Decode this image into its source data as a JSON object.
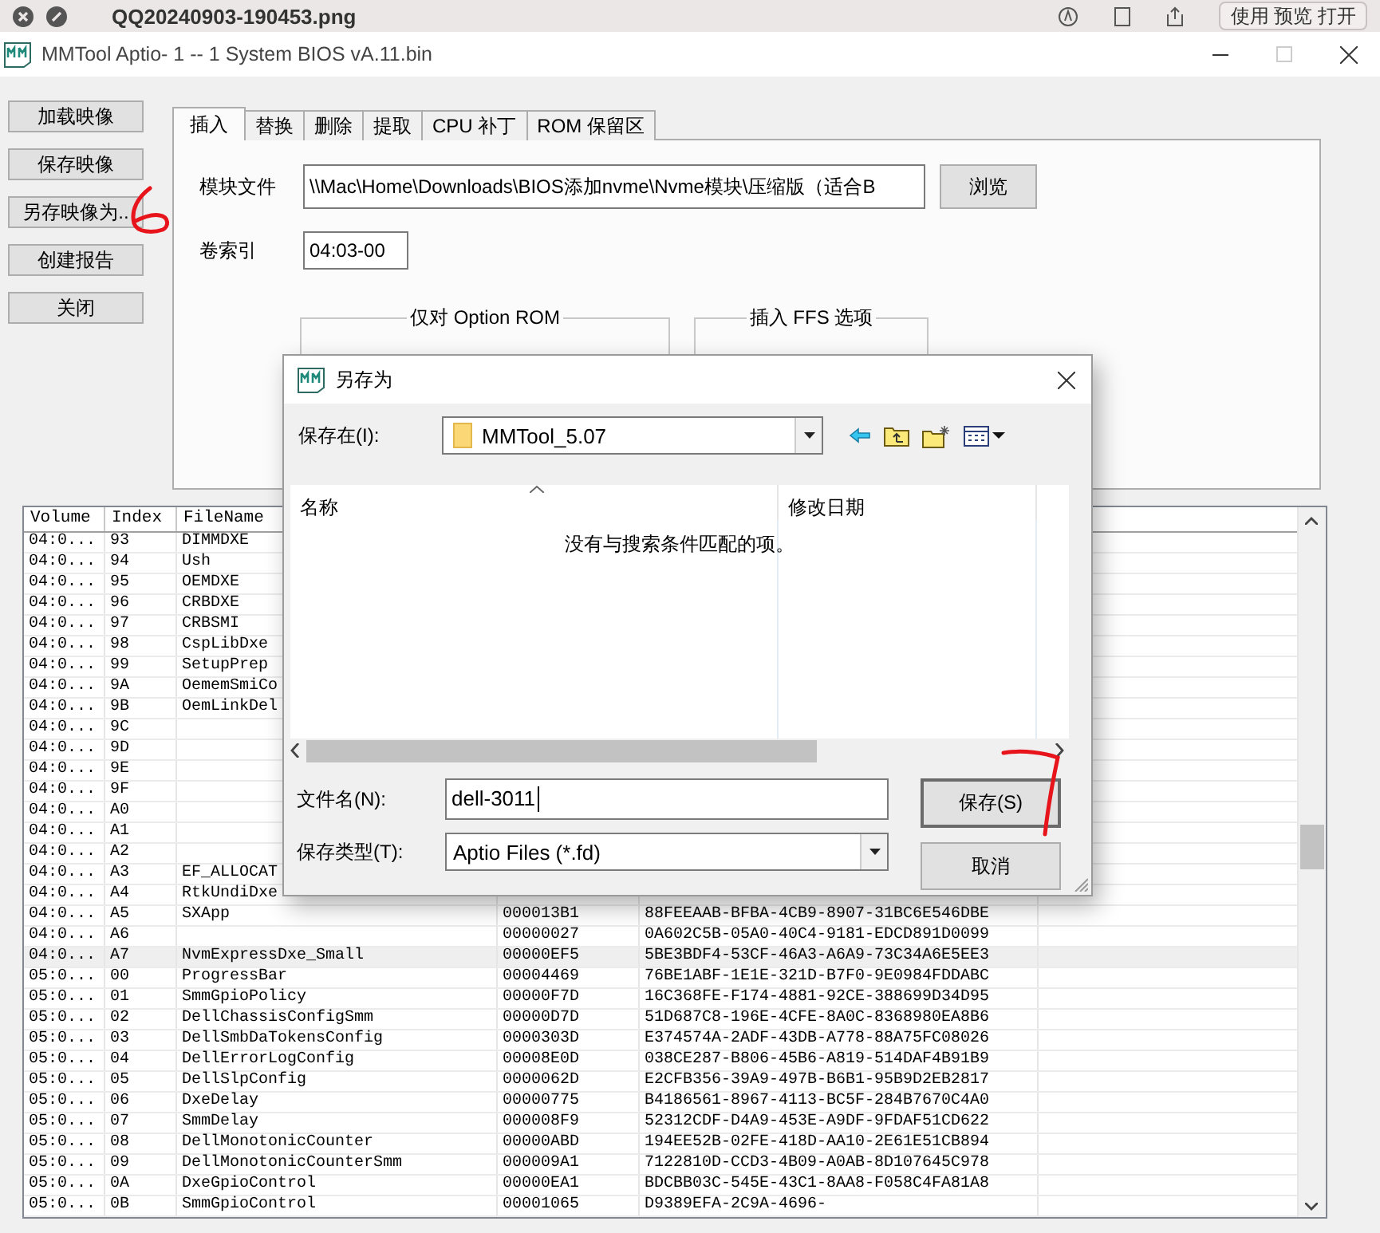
{
  "viewer_bar": {
    "file_name": "QQ20240903-190453.png",
    "open_button": "使用 预览 打开"
  },
  "window": {
    "title": "MMTool Aptio- 1 -- 1 System BIOS vA.11.bin"
  },
  "side_buttons": [
    "加载映像",
    "保存映像",
    "另存映像为..",
    "创建报告",
    "关闭"
  ],
  "tabs": [
    {
      "label": "插入",
      "selected": true
    },
    {
      "label": "替换",
      "selected": false
    },
    {
      "label": "删除",
      "selected": false
    },
    {
      "label": "提取",
      "selected": false
    },
    {
      "label": "CPU 补丁",
      "selected": false
    },
    {
      "label": "ROM 保留区",
      "selected": false
    }
  ],
  "insert_panel": {
    "module_file": {
      "label": "模块文件",
      "value": "\\\\Mac\\Home\\Downloads\\BIOS添加nvme\\Nvme模块\\压缩版（适合B",
      "browse_button": "浏览"
    },
    "volume_index": {
      "label": "卷索引",
      "value": "04:03-00"
    },
    "groups": [
      "仅对 Option ROM",
      "插入 FFS 选项"
    ]
  },
  "table": {
    "columns": [
      "Volume",
      "Index",
      "FileName"
    ],
    "rows": [
      {
        "volume": "04:0...",
        "index": "93",
        "file_name": "DIMMDXE",
        "selected": false
      },
      {
        "volume": "04:0...",
        "index": "94",
        "file_name": "Ush",
        "selected": false
      },
      {
        "volume": "04:0...",
        "index": "95",
        "file_name": "OEMDXE",
        "selected": false
      },
      {
        "volume": "04:0...",
        "index": "96",
        "file_name": "CRBDXE",
        "selected": false
      },
      {
        "volume": "04:0...",
        "index": "97",
        "file_name": "CRBSMI",
        "selected": false
      },
      {
        "volume": "04:0...",
        "index": "98",
        "file_name": "CspLibDxe",
        "selected": false
      },
      {
        "volume": "04:0...",
        "index": "99",
        "file_name": "SetupPrep",
        "selected": false
      },
      {
        "volume": "04:0...",
        "index": "9A",
        "file_name": "OememSmiCo",
        "selected": false
      },
      {
        "volume": "04:0...",
        "index": "9B",
        "file_name": "OemLinkDel",
        "selected": false
      },
      {
        "volume": "04:0...",
        "index": "9C",
        "selected": false
      },
      {
        "volume": "04:0...",
        "index": "9D",
        "selected": false
      },
      {
        "volume": "04:0...",
        "index": "9E",
        "selected": false
      },
      {
        "volume": "04:0...",
        "index": "9F",
        "selected": false
      },
      {
        "volume": "04:0...",
        "index": "A0",
        "selected": false
      },
      {
        "volume": "04:0...",
        "index": "A1",
        "selected": false
      },
      {
        "volume": "04:0...",
        "index": "A2",
        "selected": false
      },
      {
        "volume": "04:0...",
        "index": "A3",
        "file_name": "EF_ALLOCAT",
        "selected": false
      },
      {
        "volume": "04:0...",
        "index": "A4",
        "file_name": "RtkUndiDxe",
        "selected": false
      },
      {
        "volume": "04:0...",
        "index": "A5",
        "file_name": "SXApp",
        "column_4": "000013B1",
        "column_5": "88FEEAAB-BFBA-4CB9-8907-31BC6E546DBE",
        "selected": false
      },
      {
        "volume": "04:0...",
        "index": "A6",
        "column_4": "00000027",
        "column_5": "0A602C5B-05A0-40C4-9181-EDCD891D0099",
        "selected": false
      },
      {
        "volume": "04:0...",
        "index": "A7",
        "file_name": "NvmExpressDxe_Small",
        "column_4": "00000EF5",
        "column_5": "5BE3BDF4-53CF-46A3-A6A9-73C34A6E5EE3",
        "selected": true
      },
      {
        "volume": "05:0...",
        "index": "00",
        "file_name": "ProgressBar",
        "column_4": "00004469",
        "column_5": "76BE1ABF-1E1E-321D-B7F0-9E0984FDDABC",
        "selected": false
      },
      {
        "volume": "05:0...",
        "index": "01",
        "file_name": "SmmGpioPolicy",
        "column_4": "00000F7D",
        "column_5": "16C368FE-F174-4881-92CE-388699D34D95",
        "selected": false
      },
      {
        "volume": "05:0...",
        "index": "02",
        "file_name": "DellChassisConfigSmm",
        "column_4": "00000D7D",
        "column_5": "51D687C8-196E-4CFE-8A0C-8368980EA8B6",
        "selected": false
      },
      {
        "volume": "05:0...",
        "index": "03",
        "file_name": "DellSmbDaTokensConfig",
        "column_4": "0000303D",
        "column_5": "E374574A-2ADF-43DB-A778-88A75FC08026",
        "selected": false
      },
      {
        "volume": "05:0...",
        "index": "04",
        "file_name": "DellErrorLogConfig",
        "column_4": "00008E0D",
        "column_5": "038CE287-B806-45B6-A819-514DAF4B91B9",
        "selected": false
      },
      {
        "volume": "05:0...",
        "index": "05",
        "file_name": "DellSlpConfig",
        "column_4": "0000062D",
        "column_5": "E2CFB356-39A9-497B-B6B1-95B9D2EB2817",
        "selected": false
      },
      {
        "volume": "05:0...",
        "index": "06",
        "file_name": "DxeDelay",
        "column_4": "00000775",
        "column_5": "B4186561-8967-4113-BC5F-284B7670C4A0",
        "selected": false
      },
      {
        "volume": "05:0...",
        "index": "07",
        "file_name": "SmmDelay",
        "column_4": "000008F9",
        "column_5": "52312CDF-D4A9-453E-A9DF-9FDAF51CD622",
        "selected": false
      },
      {
        "volume": "05:0...",
        "index": "08",
        "file_name": "DellMonotonicCounter",
        "column_4": "00000ABD",
        "column_5": "194EE52B-02FE-418D-AA10-2E61E51CB894",
        "selected": false
      },
      {
        "volume": "05:0...",
        "index": "09",
        "file_name": "DellMonotonicCounterSmm",
        "column_4": "000009A1",
        "column_5": "7122810D-CCD3-4B09-A0AB-8D107645C978",
        "selected": false
      },
      {
        "volume": "05:0...",
        "index": "0A",
        "file_name": "DxeGpioControl",
        "column_4": "00000EA1",
        "column_5": "BDCBB03C-545E-43C1-8AA8-F058C4FA81A8",
        "selected": false
      },
      {
        "volume": "05:0...",
        "index": "0B",
        "file_name": "SmmGpioControl",
        "column_4": "00001065",
        "column_5": "D9389EFA-2C9A-4696-",
        "selected": false
      }
    ]
  },
  "save_dialog": {
    "title": "另存为",
    "save_in": {
      "label": "保存在(I):",
      "value": "MMTool_5.07"
    },
    "columns": [
      "名称",
      "修改日期"
    ],
    "empty_message": "没有与搜索条件匹配的项。",
    "file_name": {
      "label": "文件名(N):",
      "value": "dell-3011"
    },
    "file_type": {
      "label": "保存类型(T):",
      "value": "Aptio Files (*.fd)"
    },
    "buttons": [
      {
        "label": "保存(S)",
        "default": true
      },
      {
        "label": "取消",
        "default": false
      }
    ]
  }
}
